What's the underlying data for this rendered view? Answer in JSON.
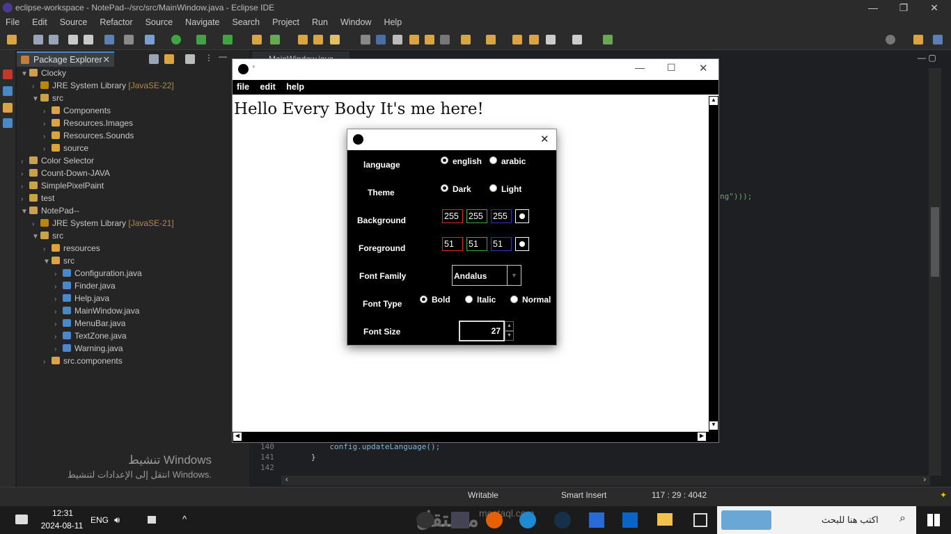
{
  "window": {
    "title": "eclipse-workspace - NotePad--/src/src/MainWindow.java - Eclipse IDE"
  },
  "menu": [
    "File",
    "Edit",
    "Source",
    "Refactor",
    "Source",
    "Navigate",
    "Search",
    "Project",
    "Run",
    "Window",
    "Help"
  ],
  "package_explorer": {
    "tab": "Package Explorer",
    "items": [
      {
        "label": "Clocky",
        "extra": ""
      },
      {
        "label": "JRE System Library",
        "extra": "[JavaSE-22]"
      },
      {
        "label": "src",
        "extra": ""
      },
      {
        "label": "Components",
        "extra": ""
      },
      {
        "label": "Resources.Images",
        "extra": ""
      },
      {
        "label": "Resources.Sounds",
        "extra": ""
      },
      {
        "label": "source",
        "extra": ""
      },
      {
        "label": "Color Selector",
        "extra": ""
      },
      {
        "label": "Count-Down-JAVA",
        "extra": ""
      },
      {
        "label": "SimplePixelPaint",
        "extra": ""
      },
      {
        "label": "test",
        "extra": ""
      },
      {
        "label": "NotePad--",
        "extra": ""
      },
      {
        "label": "JRE System Library",
        "extra": "[JavaSE-21]"
      },
      {
        "label": "src",
        "extra": ""
      },
      {
        "label": "resources",
        "extra": ""
      },
      {
        "label": "src",
        "extra": ""
      },
      {
        "label": "Configuration.java",
        "extra": ""
      },
      {
        "label": "Finder.java",
        "extra": ""
      },
      {
        "label": "Help.java",
        "extra": ""
      },
      {
        "label": "MainWindow.java",
        "extra": ""
      },
      {
        "label": "MenuBar.java",
        "extra": ""
      },
      {
        "label": "TextZone.java",
        "extra": ""
      },
      {
        "label": "Warning.java",
        "extra": ""
      },
      {
        "label": "src.components",
        "extra": ""
      }
    ]
  },
  "activation": {
    "line1": "تنشيط Windows",
    "line2": "انتقل إلى الإعدادات لتنشيط Windows."
  },
  "editor": {
    "tab": "MainWindow.java",
    "fragment": "ng\")));",
    "lines": [
      {
        "n": "140",
        "code": "            config.updateLanguage();"
      },
      {
        "n": "141",
        "code": "        }"
      },
      {
        "n": "142",
        "code": ""
      }
    ]
  },
  "status": {
    "writable": "Writable",
    "insert": "Smart Insert",
    "position": "117 : 29 : 4042"
  },
  "taskbar": {
    "time": "12:31",
    "date": "2024-08-11",
    "lang": "ENG",
    "search": "اكتب هنا للبحث",
    "watermark": "مستقل",
    "watermark_sub": "mostaql.com"
  },
  "app": {
    "title": "*",
    "menu": [
      "file",
      "edit",
      "help"
    ],
    "text": "Hello Every Body It's me here!"
  },
  "dialog": {
    "language": {
      "label": "language",
      "options": [
        "english",
        "arabic"
      ],
      "selected": "english"
    },
    "theme": {
      "label": "Theme",
      "options": [
        "Dark",
        "Light"
      ],
      "selected": "Dark"
    },
    "background": {
      "label": "Background",
      "r": "255",
      "g": "255",
      "b": "255"
    },
    "foreground": {
      "label": "Foreground",
      "r": "51",
      "g": "51",
      "b": "51"
    },
    "font_family": {
      "label": "Font Family",
      "value": "Andalus"
    },
    "font_type": {
      "label": "Font Type",
      "options": [
        "Bold",
        "Italic",
        "Normal"
      ],
      "selected": "Bold"
    },
    "font_size": {
      "label": "Font Size",
      "value": "27"
    }
  },
  "colors": {
    "red": "#e0282e",
    "green": "#2fae3f",
    "blue": "#2a35c8"
  }
}
